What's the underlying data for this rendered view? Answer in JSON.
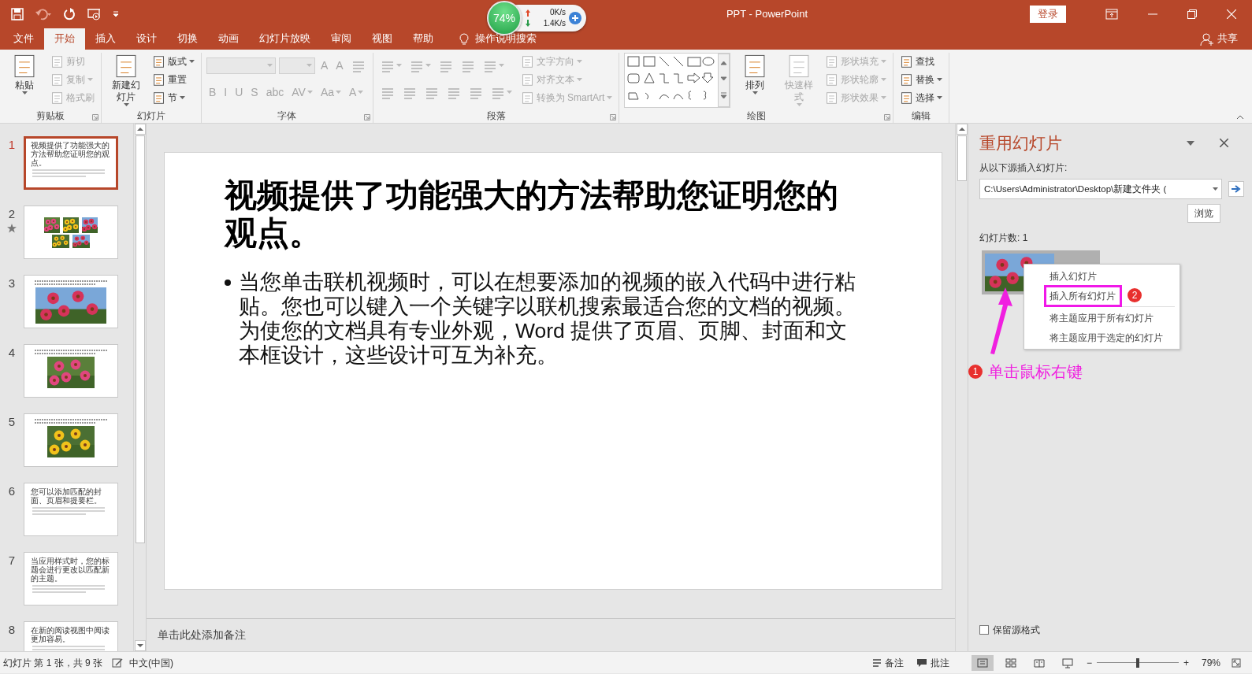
{
  "window": {
    "title": "PPT - PowerPoint",
    "sign_in": "登录",
    "share": "共享"
  },
  "net_meter": {
    "percent": "74%",
    "upload": "0K/s",
    "download": "1.4K/s"
  },
  "tabs": [
    {
      "label": "文件",
      "selected": false
    },
    {
      "label": "开始",
      "selected": true
    },
    {
      "label": "插入",
      "selected": false
    },
    {
      "label": "设计",
      "selected": false
    },
    {
      "label": "切换",
      "selected": false
    },
    {
      "label": "动画",
      "selected": false
    },
    {
      "label": "幻灯片放映",
      "selected": false
    },
    {
      "label": "审阅",
      "selected": false
    },
    {
      "label": "视图",
      "selected": false
    },
    {
      "label": "帮助",
      "selected": false
    }
  ],
  "tell_me": "操作说明搜索",
  "ribbon_groups": [
    {
      "label": "剪贴板",
      "launcher": true,
      "columns": [
        [
          {
            "kind": "large",
            "label": "粘贴",
            "caret": true,
            "disabled": false
          }
        ],
        [
          {
            "kind": "small",
            "label": "剪切",
            "caret": false,
            "disabled": true
          },
          {
            "kind": "small",
            "label": "复制",
            "caret": true,
            "disabled": true
          },
          {
            "kind": "small",
            "label": "格式刷",
            "caret": false,
            "disabled": true
          }
        ]
      ]
    },
    {
      "label": "幻灯片",
      "launcher": false,
      "columns": [
        [
          {
            "kind": "large",
            "label": "新建幻灯片",
            "caret": true,
            "disabled": false
          }
        ],
        [
          {
            "kind": "small",
            "label": "版式",
            "caret": true,
            "disabled": false
          },
          {
            "kind": "small",
            "label": "重置",
            "caret": false,
            "disabled": false
          },
          {
            "kind": "small",
            "label": "节",
            "caret": true,
            "disabled": false
          }
        ]
      ]
    },
    {
      "label": "字体",
      "launcher": true,
      "columns": [
        [
          {
            "kind": "row",
            "items": [
              {
                "kind": "field",
                "disabled": true
              },
              {
                "kind": "field",
                "disabled": true
              },
              {
                "kind": "glyph",
                "label": "A",
                "caret": false,
                "disabled": true
              },
              {
                "kind": "glyph",
                "label": "A",
                "caret": false,
                "disabled": true
              },
              {
                "kind": "icon",
                "caret": false,
                "disabled": true
              }
            ]
          },
          {
            "kind": "row",
            "items": [
              {
                "kind": "glyph",
                "label": "B",
                "caret": false,
                "disabled": true
              },
              {
                "kind": "glyph",
                "label": "I",
                "caret": false,
                "disabled": true
              },
              {
                "kind": "glyph",
                "label": "U",
                "caret": false,
                "disabled": true
              },
              {
                "kind": "glyph",
                "label": "S",
                "caret": false,
                "disabled": true
              },
              {
                "kind": "glyph",
                "label": "abc",
                "caret": false,
                "disabled": true
              },
              {
                "kind": "glyph",
                "label": "AV",
                "caret": true,
                "disabled": true
              },
              {
                "kind": "glyph",
                "label": "Aa",
                "caret": true,
                "disabled": true
              },
              {
                "kind": "glyph",
                "label": "A",
                "caret": true,
                "disabled": true
              }
            ]
          }
        ]
      ]
    },
    {
      "label": "段落",
      "launcher": true,
      "columns": [
        [
          {
            "kind": "row",
            "items": [
              {
                "kind": "icon",
                "caret": true,
                "disabled": true
              },
              {
                "kind": "icon",
                "caret": true,
                "disabled": true
              },
              {
                "kind": "icon",
                "caret": false,
                "disabled": true
              },
              {
                "kind": "icon",
                "caret": false,
                "disabled": true
              },
              {
                "kind": "icon",
                "caret": true,
                "disabled": true
              }
            ]
          },
          {
            "kind": "row",
            "items": [
              {
                "kind": "icon",
                "caret": false,
                "disabled": true
              },
              {
                "kind": "icon",
                "caret": false,
                "disabled": true
              },
              {
                "kind": "icon",
                "caret": false,
                "disabled": true
              },
              {
                "kind": "icon",
                "caret": false,
                "disabled": true
              },
              {
                "kind": "icon",
                "caret": false,
                "disabled": true
              },
              {
                "kind": "icon",
                "caret": true,
                "disabled": true
              }
            ]
          }
        ],
        [
          {
            "kind": "small",
            "label": "文字方向",
            "caret": true,
            "disabled": true
          },
          {
            "kind": "small",
            "label": "对齐文本",
            "caret": true,
            "disabled": true
          },
          {
            "kind": "small",
            "label": "转换为 SmartArt",
            "caret": true,
            "disabled": true
          }
        ]
      ]
    },
    {
      "label": "绘图",
      "launcher": true,
      "columns": [
        [
          {
            "kind": "gallery"
          }
        ],
        [
          {
            "kind": "large",
            "label": "排列",
            "caret": true,
            "disabled": false
          }
        ],
        [
          {
            "kind": "large",
            "label": "快速样式",
            "caret": true,
            "disabled": true
          }
        ],
        [
          {
            "kind": "small",
            "label": "形状填充",
            "caret": true,
            "disabled": true
          },
          {
            "kind": "small",
            "label": "形状轮廓",
            "caret": true,
            "disabled": true
          },
          {
            "kind": "small",
            "label": "形状效果",
            "caret": true,
            "disabled": true
          }
        ]
      ]
    },
    {
      "label": "编辑",
      "launcher": false,
      "columns": [
        [
          {
            "kind": "small",
            "label": "查找",
            "caret": false,
            "disabled": false
          },
          {
            "kind": "small",
            "label": "替换",
            "caret": true,
            "disabled": false
          },
          {
            "kind": "small",
            "label": "选择",
            "caret": true,
            "disabled": false
          }
        ]
      ]
    }
  ],
  "slides": [
    {
      "number": "1",
      "selected": true,
      "starred": false,
      "kind": "text",
      "title": "视频提供了功能强大的方法帮助您证明您的观点。"
    },
    {
      "number": "2",
      "selected": false,
      "starred": true,
      "kind": "photos"
    },
    {
      "number": "3",
      "selected": false,
      "starred": false,
      "kind": "caption_photo"
    },
    {
      "number": "4",
      "selected": false,
      "starred": false,
      "kind": "caption_photo"
    },
    {
      "number": "5",
      "selected": false,
      "starred": false,
      "kind": "caption_photo"
    },
    {
      "number": "6",
      "selected": false,
      "starred": false,
      "kind": "text",
      "title": "您可以添加匹配的封面、页眉和提要栏。"
    },
    {
      "number": "7",
      "selected": false,
      "starred": false,
      "kind": "text",
      "title": "当应用样式时，您的标题会进行更改以匹配新的主题。"
    },
    {
      "number": "8",
      "selected": false,
      "starred": false,
      "kind": "text",
      "title": "在新的阅读视图中阅读更加容易。"
    }
  ],
  "slide": {
    "title": "视频提供了功能强大的方法帮助您证明您的观点。",
    "bullets": [
      "当您单击联机视频时，可以在想要添加的视频的嵌入代码中进行粘贴。您也可以键入一个关键字以联机搜索最适合您的文档的视频。为使您的文档具有专业外观，Word 提供了页眉、页脚、封面和文本框设计，这些设计可互为补充。"
    ]
  },
  "notes_placeholder": "单击此处添加备注",
  "reuse_pane": {
    "title": "重用幻灯片",
    "source_label": "从以下源插入幻灯片:",
    "source_path": "C:\\Users\\Administrator\\Desktop\\新建文件夹 (",
    "browse": "浏览",
    "count": "幻灯片数: 1",
    "context_menu": [
      {
        "label": "插入幻灯片",
        "annotated": false
      },
      {
        "label": "插入所有幻灯片",
        "annotated": true
      },
      {
        "label": "将主题应用于所有幻灯片",
        "annotated": false
      },
      {
        "label": "将主题应用于选定的幻灯片",
        "annotated": false
      }
    ],
    "annotations": [
      {
        "number": "1",
        "text": "单击鼠标右键"
      },
      {
        "number": "2"
      }
    ],
    "keep_format": {
      "label": "保留源格式",
      "checked": false
    }
  },
  "status_bar": {
    "slide_info": "幻灯片 第 1 张，共 9 张",
    "language": "中文(中国)",
    "notes": "备注",
    "comments": "批注",
    "views": [
      {
        "selected": true
      },
      {
        "selected": false
      },
      {
        "selected": false
      },
      {
        "selected": false
      }
    ],
    "zoom_minus": "−",
    "zoom_plus": "+",
    "zoom": {
      "level": 0.48
    },
    "zoom_text": "79%"
  }
}
